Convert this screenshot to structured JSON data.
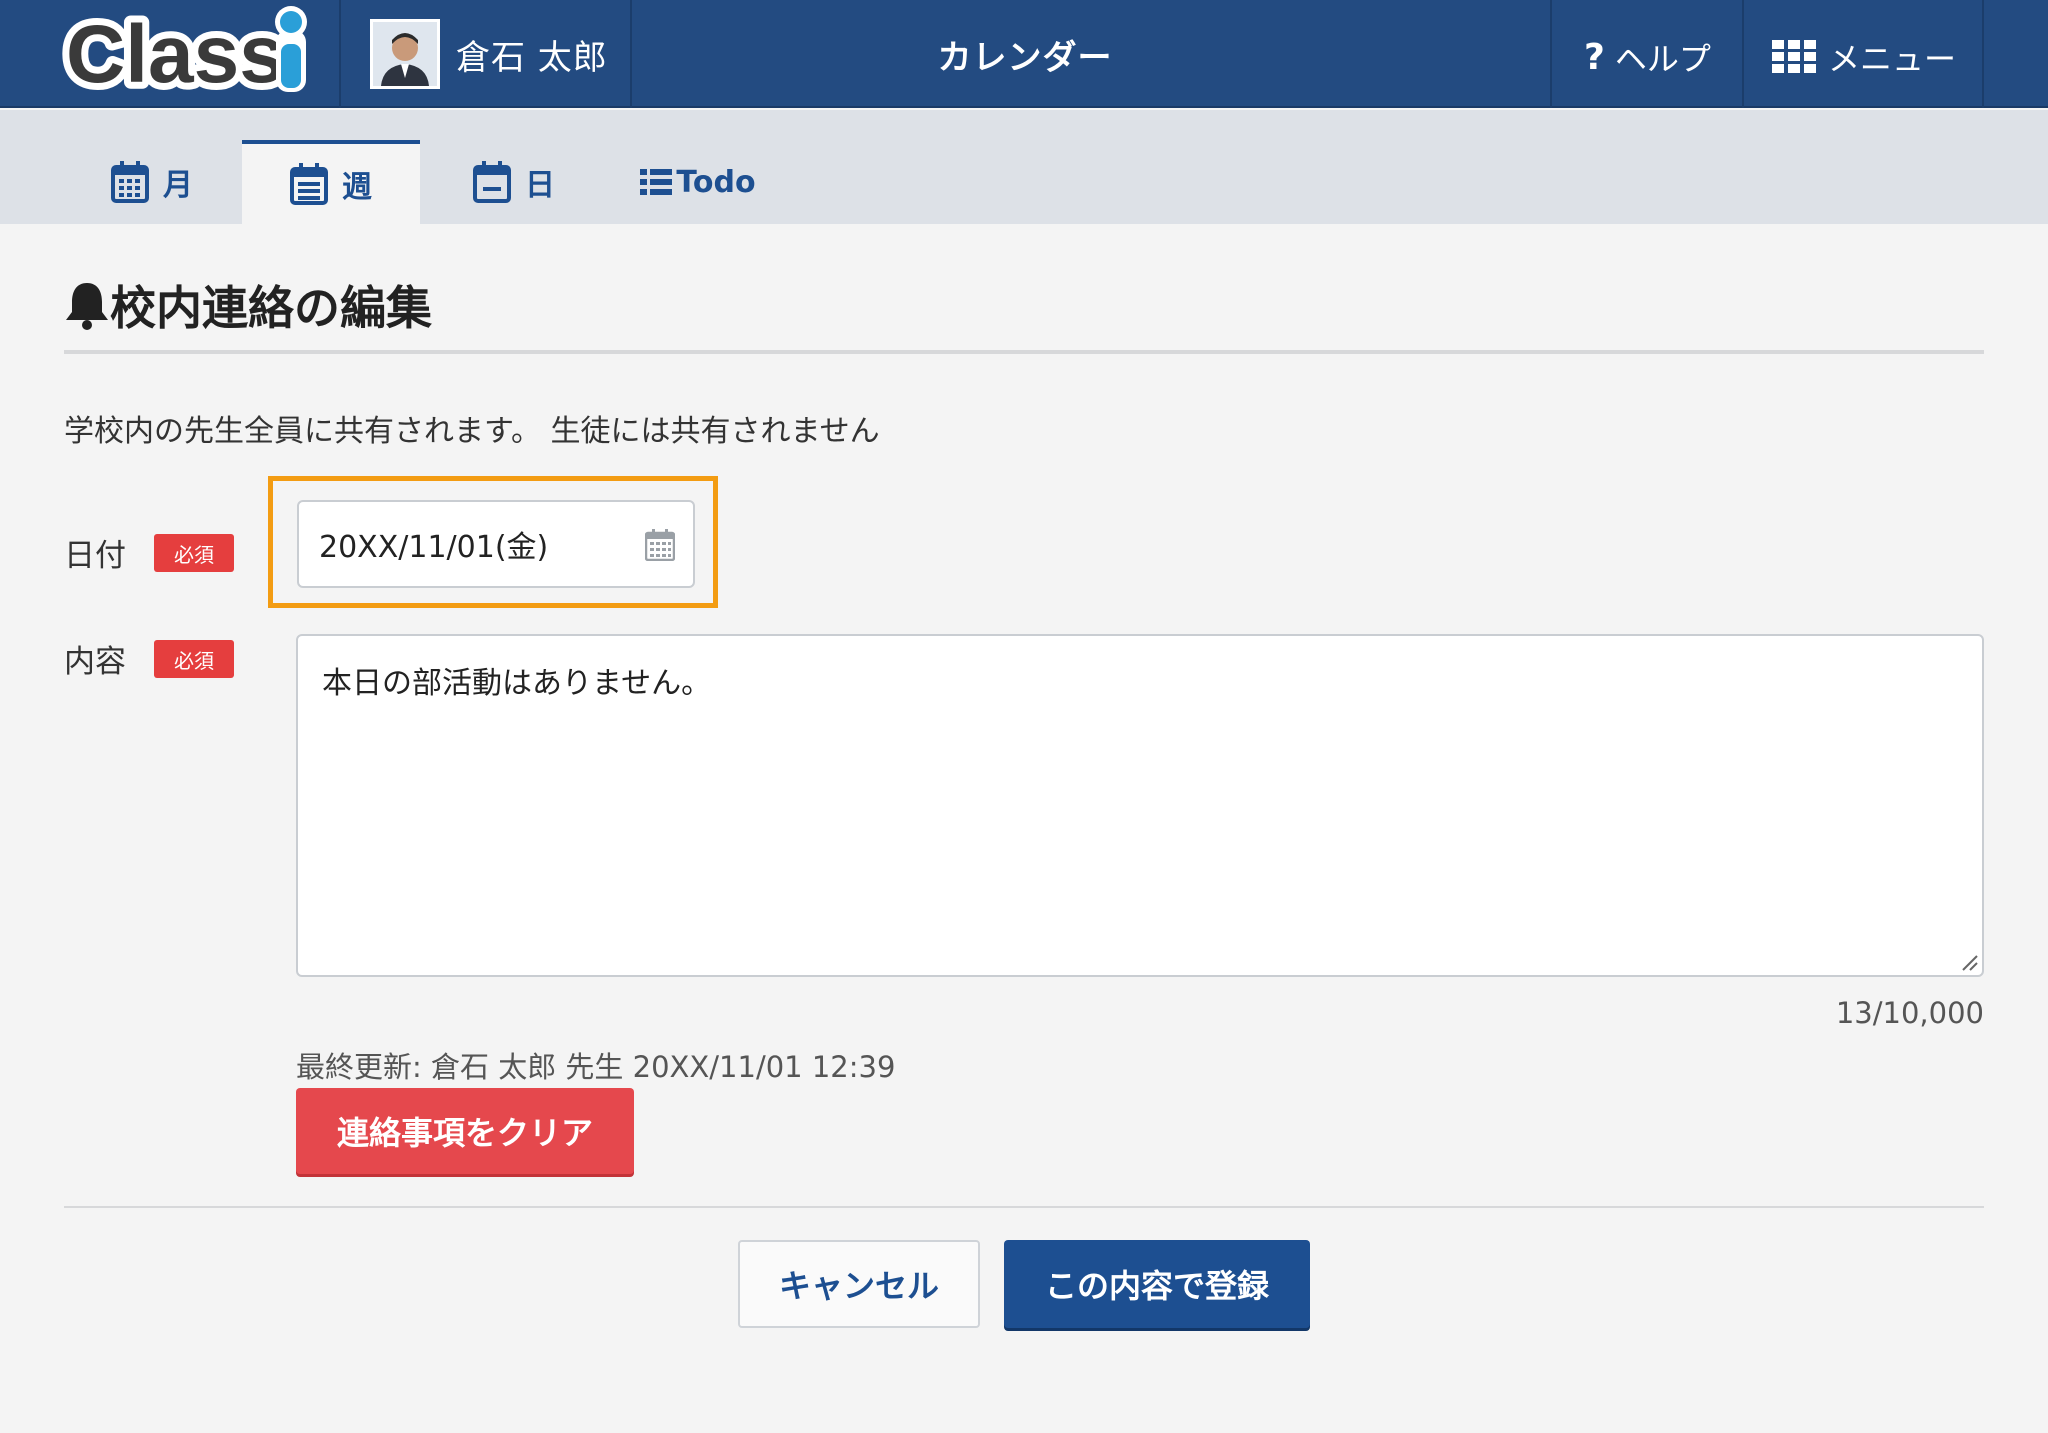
{
  "header": {
    "logo_text": "Classi",
    "user_name": "倉石 太郎",
    "title": "カレンダー",
    "help_label": "ヘルプ",
    "menu_label": "メニュー"
  },
  "tabs": [
    {
      "label": "月",
      "icon": "calendar-month-icon",
      "active": false
    },
    {
      "label": "週",
      "icon": "calendar-week-icon",
      "active": true
    },
    {
      "label": "日",
      "icon": "calendar-day-icon",
      "active": false
    },
    {
      "label": "Todo",
      "icon": "list-icon",
      "active": false
    }
  ],
  "page": {
    "title": "校内連絡の編集",
    "title_icon": "bell-icon",
    "description": "学校内の先生全員に共有されます。 生徒には共有されません"
  },
  "form": {
    "date": {
      "label": "日付",
      "required_badge": "必須",
      "value": "20XX/11/01(金)"
    },
    "content": {
      "label": "内容",
      "required_badge": "必須",
      "value": "本日の部活動はありません。",
      "char_count": "13/10,000"
    },
    "last_updated": "最終更新: 倉石 太郎 先生 20XX/11/01 12:39",
    "clear_button": "連絡事項をクリア",
    "cancel_button": "キャンセル",
    "submit_button": "この内容で登録"
  },
  "colors": {
    "header_bg": "#234b81",
    "accent_blue": "#1d4f91",
    "danger_red": "#e5484d",
    "highlight_orange": "#f39c12"
  }
}
